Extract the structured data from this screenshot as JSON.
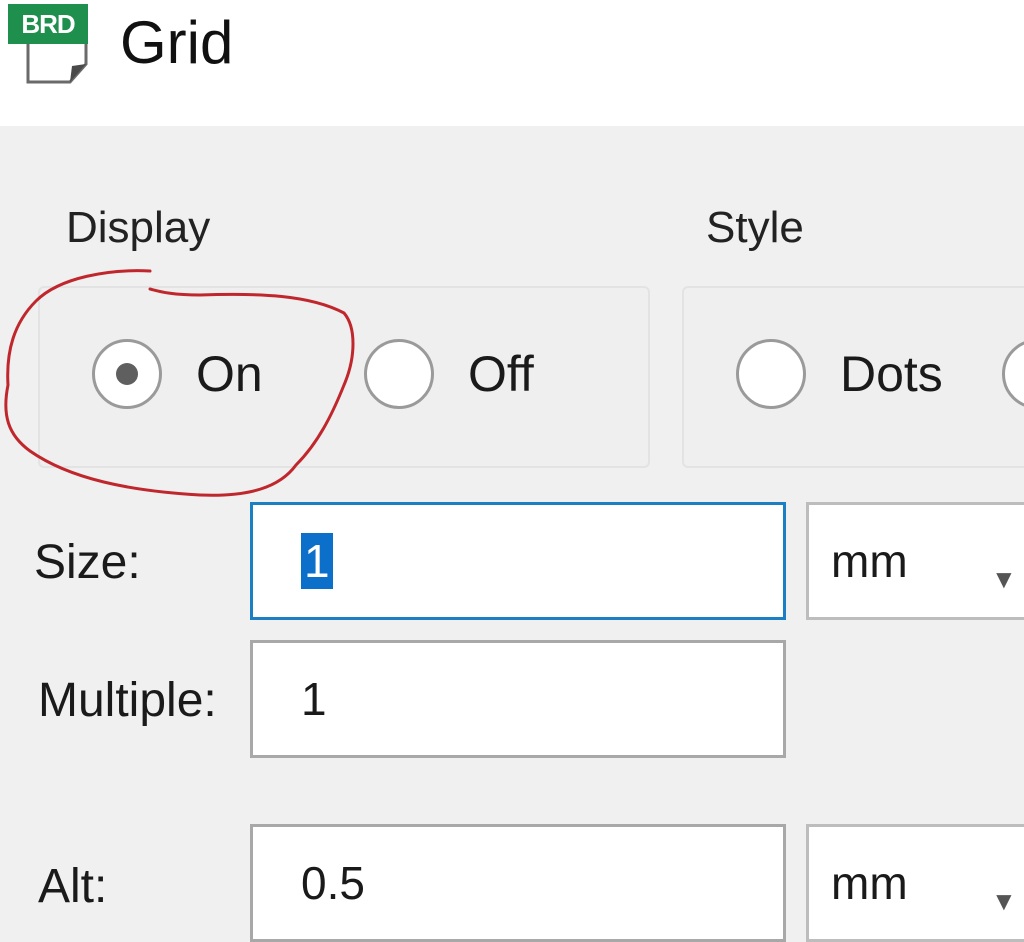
{
  "window": {
    "icon_text": "BRD",
    "icon": "brd-document-icon",
    "title": "Grid"
  },
  "display": {
    "label": "Display",
    "options": [
      {
        "label": "On",
        "selected": true
      },
      {
        "label": "Off",
        "selected": false
      }
    ]
  },
  "style": {
    "label": "Style",
    "options": [
      {
        "label": "Dots",
        "selected": false
      }
    ]
  },
  "size": {
    "label": "Size:",
    "value": "1",
    "unit": "mm"
  },
  "multiple": {
    "label": "Multiple:",
    "value": "1"
  },
  "alt": {
    "label": "Alt:",
    "value": "0.5",
    "unit": "mm"
  },
  "colors": {
    "annotation": "#c0272d",
    "focus_border": "#1c7fc4",
    "selection": "#0c6fc9",
    "icon_badge": "#1f8f4e"
  }
}
